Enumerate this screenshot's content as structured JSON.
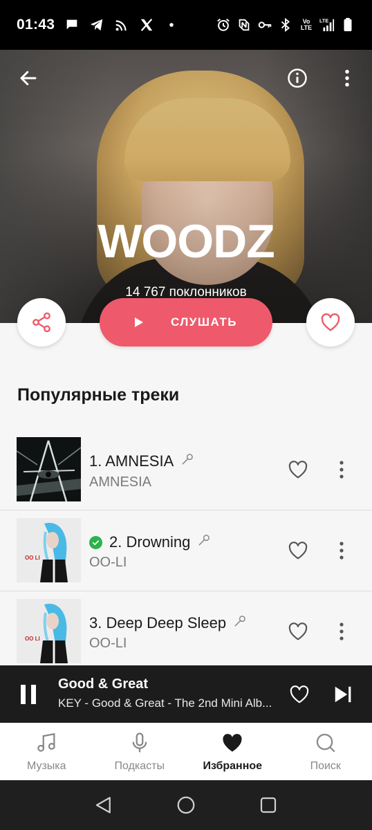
{
  "status_bar": {
    "time": "01:43",
    "left_icons": [
      "chat-icon",
      "telegram-icon",
      "cast-icon",
      "x-icon",
      "dot-icon"
    ],
    "right_icons": [
      "alarm-icon",
      "nfc-icon",
      "key-icon",
      "bluetooth-icon",
      "volte-icon",
      "lte-signal-icon",
      "battery-icon"
    ],
    "volte_text": "Vo LTE",
    "lte_text": "LTE"
  },
  "hero": {
    "artist_name": "WOODZ",
    "followers": "14 767 поклонников"
  },
  "actions": {
    "play_label": "СЛУШАТЬ"
  },
  "section": {
    "title": "Популярные треки"
  },
  "tracks": [
    {
      "title": "1. AMNESIA",
      "album": "AMNESIA",
      "downloaded": false,
      "cover_text": ""
    },
    {
      "title": "2. Drowning",
      "album": "OO-LI",
      "downloaded": true,
      "cover_text": "OO LI"
    },
    {
      "title": "3. Deep Deep Sleep",
      "album": "OO-LI",
      "downloaded": false,
      "cover_text": "OO LI"
    }
  ],
  "mini_player": {
    "title": "Good & Great",
    "subtitle": "KEY - Good & Great - The 2nd Mini Alb..."
  },
  "bottom_nav": [
    {
      "label": "Музыка",
      "icon": "music-note-icon",
      "active": false
    },
    {
      "label": "Подкасты",
      "icon": "microphone-icon",
      "active": false
    },
    {
      "label": "Избранное",
      "icon": "heart-icon",
      "active": true
    },
    {
      "label": "Поиск",
      "icon": "search-icon",
      "active": false
    }
  ],
  "colors": {
    "accent": "#ee5a6b",
    "check": "#2bb24c",
    "mini_player_bg": "#1c1c1c"
  }
}
